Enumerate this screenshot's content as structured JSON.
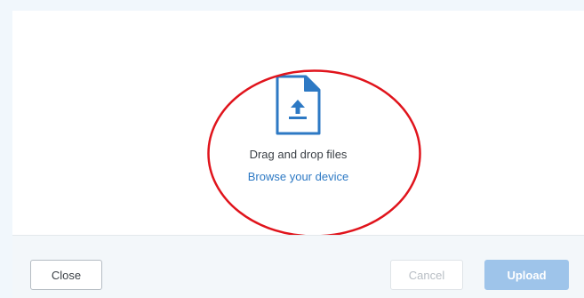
{
  "dropzone": {
    "icon": "file-upload-icon",
    "drag_text": "Drag and drop files",
    "browse_link": "Browse your device"
  },
  "footer": {
    "close_label": "Close",
    "cancel_label": "Cancel",
    "upload_label": "Upload"
  },
  "colors": {
    "accent": "#2d79c4",
    "upload_disabled": "#9ec4ea",
    "annotation": "#e0141c"
  }
}
